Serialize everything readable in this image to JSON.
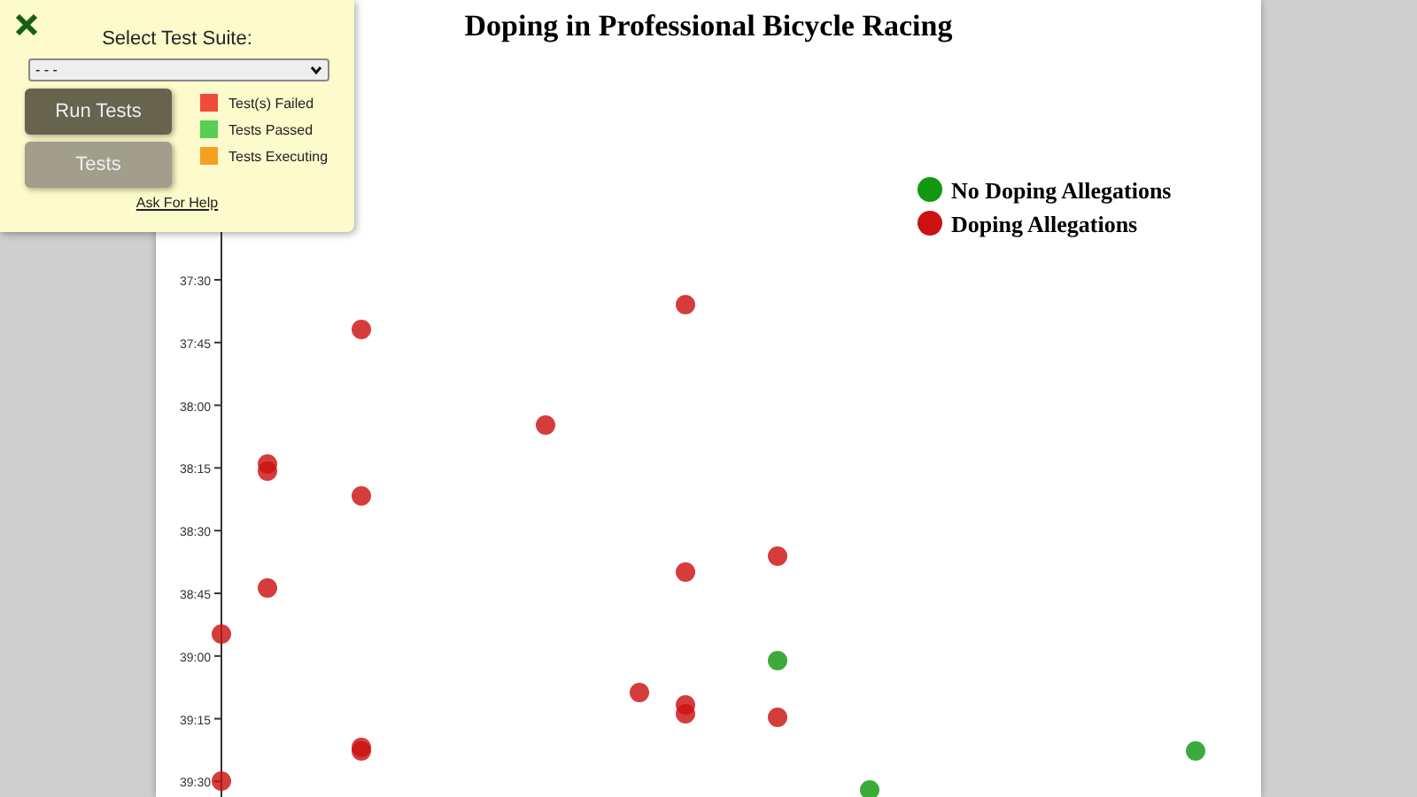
{
  "test_panel": {
    "title": "Select Test Suite:",
    "suite_select": {
      "value": "- - -"
    },
    "buttons": [
      {
        "label": "Run Tests",
        "kind": "primary"
      },
      {
        "label": "Tests",
        "kind": "secondary"
      }
    ],
    "status_legend": [
      {
        "label": "Test(s) Failed",
        "color": "#f04a3a"
      },
      {
        "label": "Tests Passed",
        "color": "#55d055"
      },
      {
        "label": "Tests Executing",
        "color": "#f5a020"
      }
    ],
    "help_link": "Ask For Help"
  },
  "chart": {
    "title": "Doping in Professional Bicycle Racing",
    "y_axis_labels": [
      "37:30",
      "37:45",
      "38:00",
      "38:15",
      "38:30",
      "38:45",
      "39:00",
      "39:15",
      "39:30"
    ],
    "legend": [
      {
        "label": "No Doping Allegations",
        "color": "#119911"
      },
      {
        "label": "Doping Allegations",
        "color": "#cc1111"
      }
    ]
  }
}
